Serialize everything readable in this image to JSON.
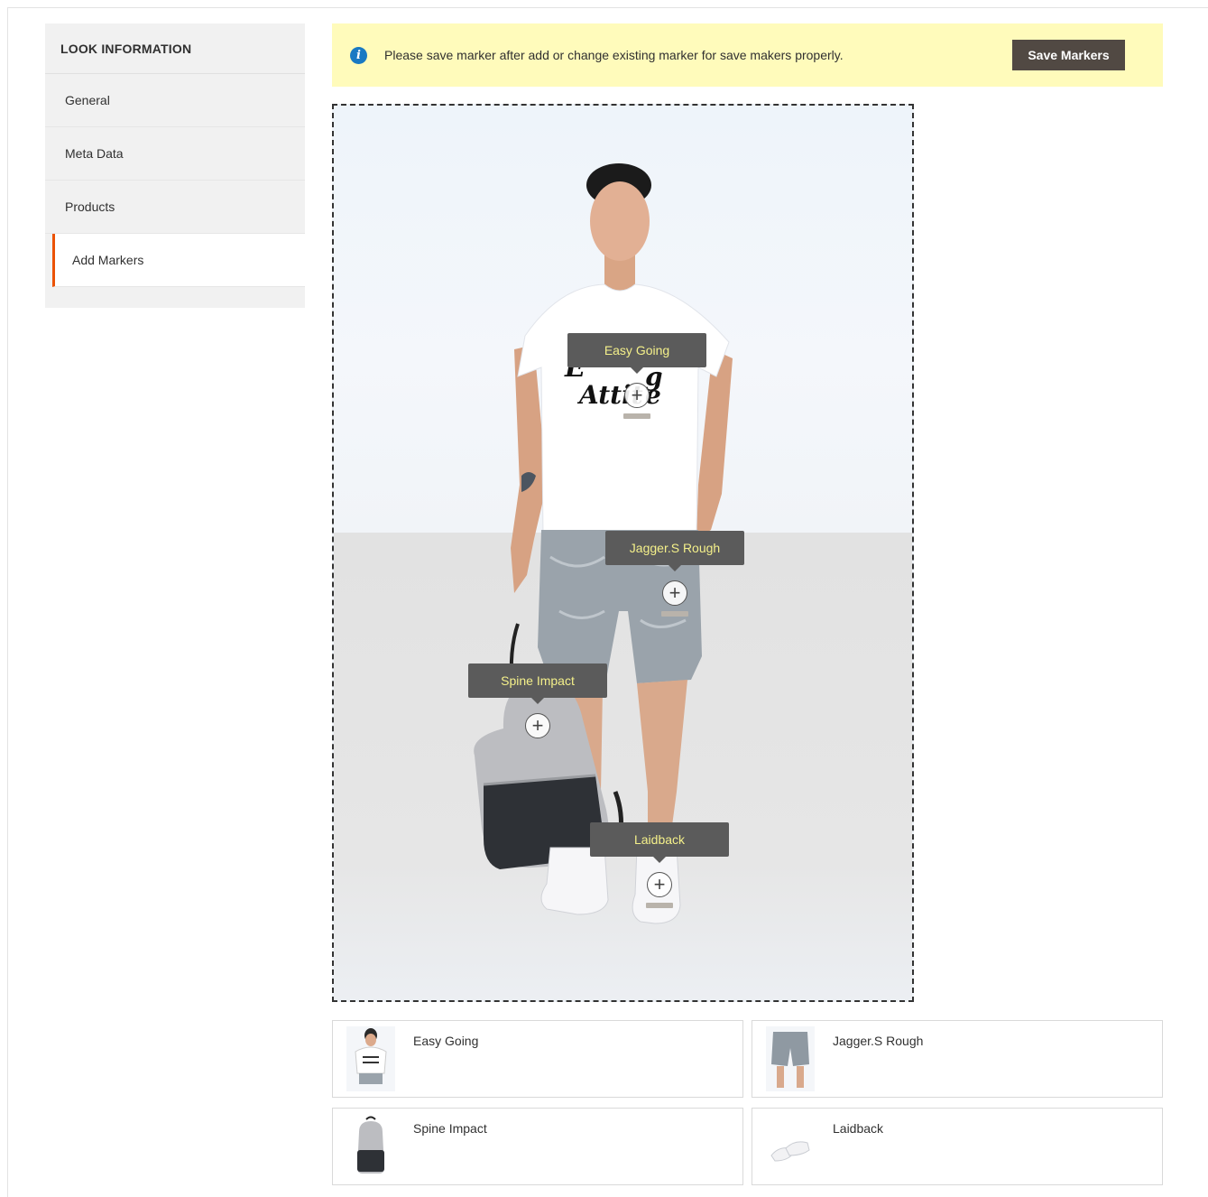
{
  "sidebar": {
    "title": "LOOK INFORMATION",
    "items": [
      {
        "label": "General"
      },
      {
        "label": "Meta Data"
      },
      {
        "label": "Products"
      },
      {
        "label": "Add Markers"
      }
    ]
  },
  "notice": {
    "icon": "info-icon",
    "text": "Please save marker after add or change existing marker for save makers properly.",
    "button_label": "Save Markers"
  },
  "markers": [
    {
      "label": "Easy Going",
      "icon": "plus-icon"
    },
    {
      "label": "Jagger.S Rough",
      "icon": "plus-icon"
    },
    {
      "label": "Spine Impact",
      "icon": "plus-icon"
    },
    {
      "label": "Laidback",
      "icon": "plus-icon"
    }
  ],
  "products": [
    {
      "name": "Easy Going",
      "thumb": "t-shirt-thumbnail"
    },
    {
      "name": "Jagger.S Rough",
      "thumb": "shorts-thumbnail"
    },
    {
      "name": "Spine Impact",
      "thumb": "backpack-thumbnail"
    },
    {
      "name": "Laidback",
      "thumb": "sneakers-thumbnail"
    }
  ],
  "colors": {
    "accent": "#eb5202",
    "notice_bg": "#fffbbb",
    "button_bg": "#514943",
    "marker_bg": "#5b5b5b",
    "marker_text": "#f4f08a",
    "info_icon": "#1979c3"
  }
}
